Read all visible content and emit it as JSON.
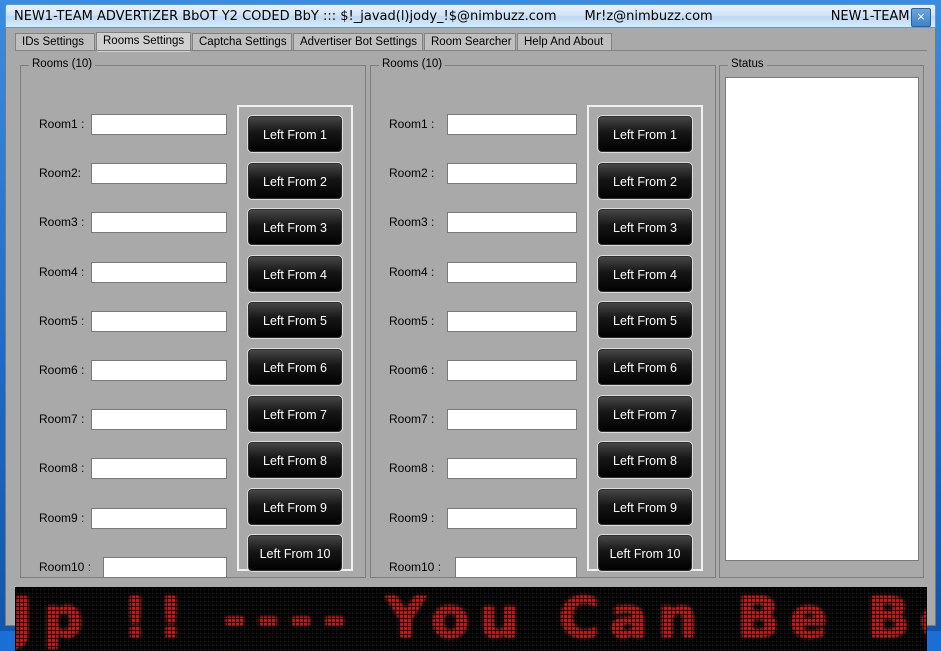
{
  "window": {
    "title_main": "NEW1-TEAM ADVERTiZER BbOT Y2 CODED BbY ::: $!_javad(l)jody_!$@nimbuzz.com",
    "title_mail": "Mr!z@nimbuzz.com",
    "title_team": "NEW1-TEAM",
    "close_label": "×"
  },
  "tabs": [
    {
      "label": "IDs Settings",
      "selected": false
    },
    {
      "label": "Rooms Settings",
      "selected": true
    },
    {
      "label": "Captcha Settings",
      "selected": false
    },
    {
      "label": "Advertiser Bot Settings",
      "selected": false
    },
    {
      "label": "Room Searcher",
      "selected": false
    },
    {
      "label": "Help And About",
      "selected": false
    }
  ],
  "left_group": {
    "title": "Rooms (10)",
    "rows": [
      {
        "label": "Room1 :",
        "value": ""
      },
      {
        "label": "Room2:",
        "value": ""
      },
      {
        "label": "Room3 :",
        "value": ""
      },
      {
        "label": "Room4 :",
        "value": ""
      },
      {
        "label": "Room5 :",
        "value": ""
      },
      {
        "label": "Room6 :",
        "value": ""
      },
      {
        "label": "Room7 :",
        "value": ""
      },
      {
        "label": "Room8 :",
        "value": ""
      },
      {
        "label": "Room9 :",
        "value": ""
      },
      {
        "label": "Room10 :",
        "value": ""
      }
    ],
    "buttons": [
      {
        "label": "Left From 1"
      },
      {
        "label": "Left From 2"
      },
      {
        "label": "Left From 3"
      },
      {
        "label": "Left From 4"
      },
      {
        "label": "Left From 5"
      },
      {
        "label": "Left From 6"
      },
      {
        "label": "Left From 7"
      },
      {
        "label": "Left From 8"
      },
      {
        "label": "Left From  9"
      },
      {
        "label": "Left From 10"
      }
    ]
  },
  "right_group": {
    "title": "Rooms (10)",
    "rows": [
      {
        "label": "Room1 :",
        "value": ""
      },
      {
        "label": "Room2 :",
        "value": ""
      },
      {
        "label": "Room3 :",
        "value": ""
      },
      {
        "label": "Room4 :",
        "value": ""
      },
      {
        "label": "Room5 :",
        "value": ""
      },
      {
        "label": "Room6 :",
        "value": ""
      },
      {
        "label": "Room7 :",
        "value": ""
      },
      {
        "label": "Room8 :",
        "value": ""
      },
      {
        "label": "Room9 :",
        "value": ""
      },
      {
        "label": "Room10 :",
        "value": ""
      }
    ],
    "buttons": [
      {
        "label": "Left From 1"
      },
      {
        "label": "Left From 2"
      },
      {
        "label": "Left From 3"
      },
      {
        "label": "Left From 4"
      },
      {
        "label": "Left From 5"
      },
      {
        "label": "Left From 6"
      },
      {
        "label": "Left From 7"
      },
      {
        "label": "Left From 8"
      },
      {
        "label": "Left From 9"
      },
      {
        "label": "Left From 10"
      }
    ]
  },
  "status": {
    "title": "Status",
    "content": ""
  },
  "marquee": {
    "text": "Jp !! ---- You Can  Be  Best Dont Giu  Up",
    "color": "#e10b0b"
  }
}
